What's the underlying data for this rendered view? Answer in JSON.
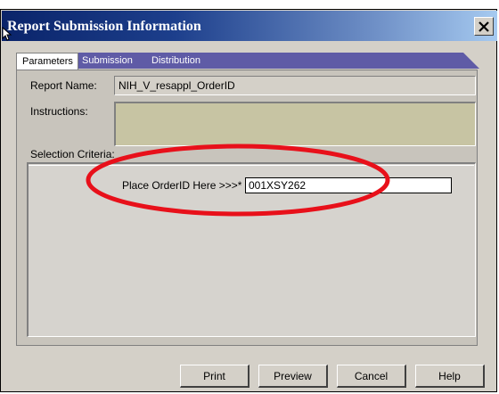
{
  "window": {
    "title": "Report Submission Information",
    "close_glyph": "✕"
  },
  "tabs": [
    {
      "label": "Parameters",
      "active": true
    },
    {
      "label": "Submission",
      "active": false
    },
    {
      "label": "Distribution",
      "active": false
    }
  ],
  "form": {
    "report_name_label": "Report Name:",
    "report_name_value": "NIH_V_resappl_OrderID",
    "instructions_label": "Instructions:",
    "instructions_value": "",
    "selection_criteria_label": "Selection Criteria:",
    "orderid_prompt": "Place OrderID Here >>>*",
    "orderid_value": "001XSY262"
  },
  "buttons": {
    "print": "Print",
    "preview": "Preview",
    "cancel": "Cancel",
    "help": "Help"
  },
  "colors": {
    "titlebar_start": "#0a246a",
    "titlebar_end": "#a6caf0",
    "tab_strip": "#5f5ba6",
    "instructions_bg": "#c7c4a3",
    "annotation": "#e8101a"
  },
  "icons": {
    "close": "close-icon",
    "cursor": "mouse-pointer-icon"
  }
}
